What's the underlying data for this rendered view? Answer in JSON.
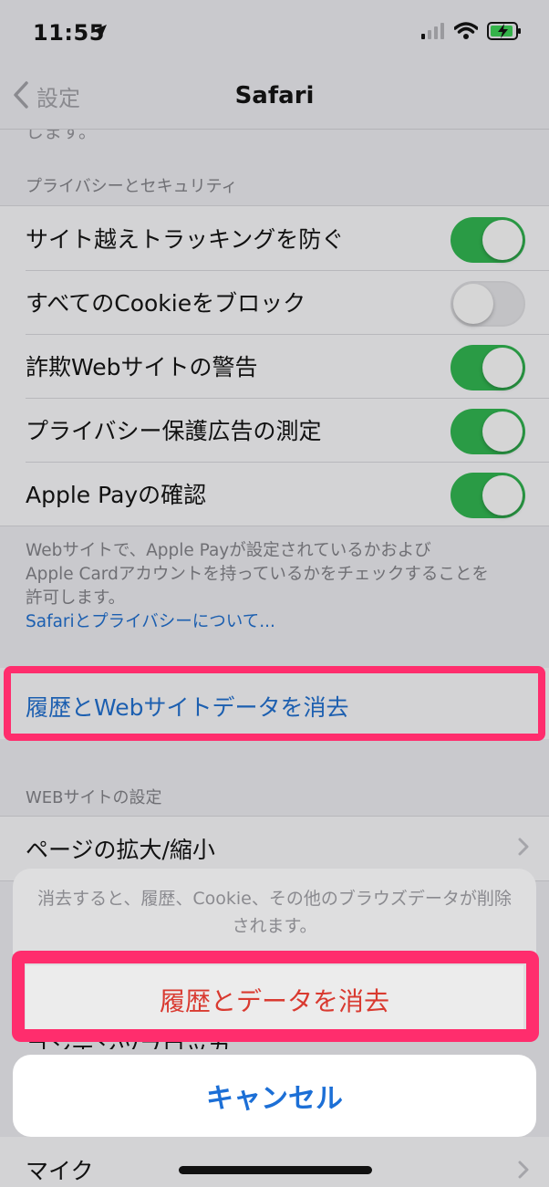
{
  "status_bar": {
    "time": "11:55"
  },
  "nav": {
    "back_label": "設定",
    "title": "Safari"
  },
  "clipped_line": "します。",
  "privacy": {
    "header": "プライバシーとセキュリティ",
    "rows": [
      {
        "label": "サイト越えトラッキングを防ぐ",
        "toggle": "on"
      },
      {
        "label": "すべてのCookieをブロック",
        "toggle": "off"
      },
      {
        "label": "詐欺Webサイトの警告",
        "toggle": "on"
      },
      {
        "label": "プライバシー保護広告の測定",
        "toggle": "on"
      },
      {
        "label": "Apple Payの確認",
        "toggle": "on"
      }
    ],
    "footer_line1": "Webサイトで、Apple Payが設定されているかおよび",
    "footer_line2": "Apple Cardアカウントを持っているかをチェックすることを",
    "footer_line3": "許可します。",
    "footer_link": "Safariとプライバシーについて..."
  },
  "clear_history_label": "履歴とWebサイトデータを消去",
  "websites": {
    "header": "WEBサイトの設定",
    "row1_label": "ページの拡大/縮小",
    "peek_label": "コンテンツブロッカ",
    "bottom_label": "マイク"
  },
  "action_sheet": {
    "message": "消去すると、履歴、Cookie、その他のブラウズデータが削除されます。",
    "destructive_label": "履歴とデータを消去",
    "cancel_label": "キャンセル"
  },
  "colors": {
    "accent_blue": "#1c5fb0",
    "toggle_green": "#2a9b45",
    "destructive_red": "#d93a30",
    "highlight": "#ff2d6d"
  }
}
